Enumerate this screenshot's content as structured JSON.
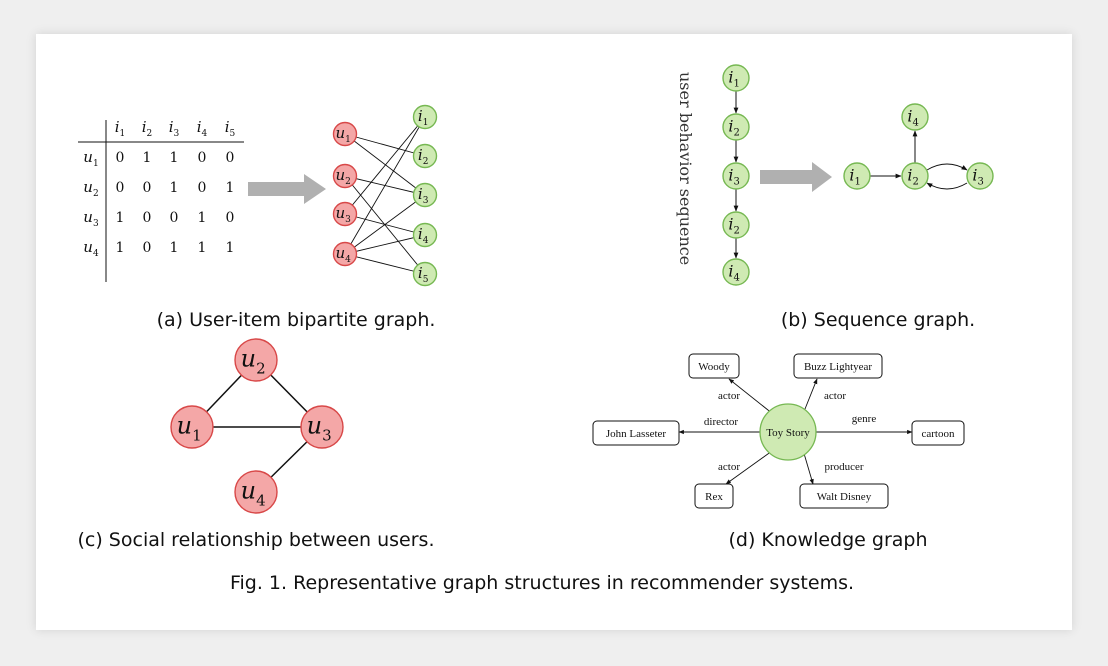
{
  "colors": {
    "red_fill": "#f4a7a7",
    "red_stroke": "#d84848",
    "green_fill": "#cfeab3",
    "green_stroke": "#76b852",
    "arrow_gray": "#b0b0b0"
  },
  "panel_a": {
    "table_cols": [
      "i1",
      "i2",
      "i3",
      "i4",
      "i5"
    ],
    "table_rows": [
      {
        "user": "u1",
        "values": [
          0,
          1,
          1,
          0,
          0
        ]
      },
      {
        "user": "u2",
        "values": [
          0,
          0,
          1,
          0,
          1
        ]
      },
      {
        "user": "u3",
        "values": [
          1,
          0,
          0,
          1,
          0
        ]
      },
      {
        "user": "u4",
        "values": [
          1,
          0,
          1,
          1,
          1
        ]
      }
    ],
    "user_nodes": [
      "u1",
      "u2",
      "u3",
      "u4"
    ],
    "item_nodes": [
      "i1",
      "i2",
      "i3",
      "i4",
      "i5"
    ],
    "caption": "(a) User-item bipartite graph."
  },
  "panel_b": {
    "vertical_label": "user behavior sequence",
    "sequence": [
      "i1",
      "i2",
      "i3",
      "i2",
      "i4"
    ],
    "graph_nodes": [
      "i1",
      "i2",
      "i3",
      "i4"
    ],
    "caption": "(b) Sequence graph."
  },
  "panel_c": {
    "nodes": [
      "u1",
      "u2",
      "u3",
      "u4"
    ],
    "caption": "(c) Social relationship between users."
  },
  "panel_d": {
    "center": "Toy Story",
    "entities": [
      {
        "id": "woody",
        "label": "Woody",
        "relation": "actor"
      },
      {
        "id": "buzz",
        "label": "Buzz Lightyear",
        "relation": "actor"
      },
      {
        "id": "john",
        "label": "John Lasseter",
        "relation": "director"
      },
      {
        "id": "cartoon",
        "label": "cartoon",
        "relation": "genre"
      },
      {
        "id": "rex",
        "label": "Rex",
        "relation": "actor"
      },
      {
        "id": "walt",
        "label": "Walt Disney",
        "relation": "producer"
      }
    ],
    "caption": "(d) Knowledge graph"
  },
  "figure_caption": "Fig. 1.  Representative graph structures in recommender systems."
}
